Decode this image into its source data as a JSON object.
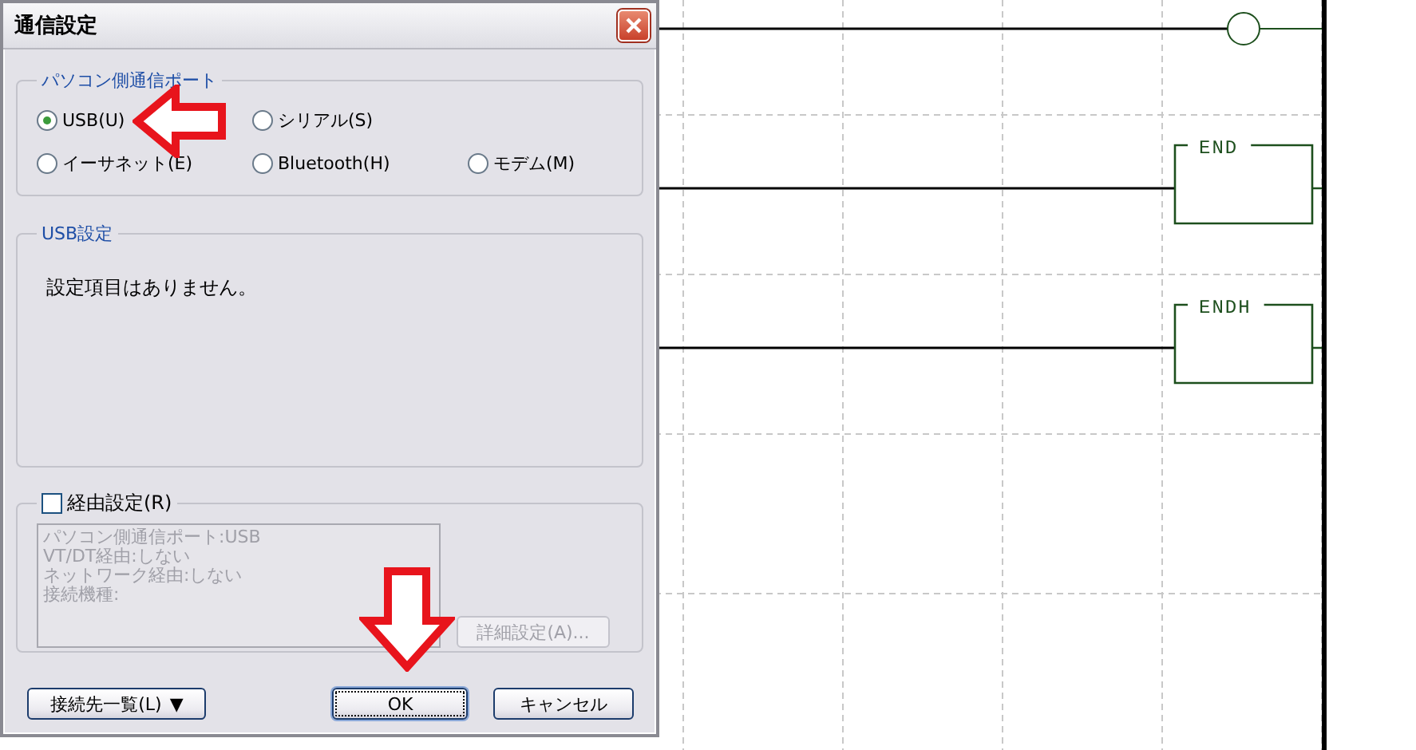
{
  "window": {
    "title": "通信設定"
  },
  "port_group": {
    "title": "パソコン側通信ポート",
    "rows": [
      [
        {
          "label": "USB(U)",
          "selected": true
        },
        {
          "label": "シリアル(S)",
          "selected": false
        }
      ],
      [
        {
          "label": "イーサネット(E)",
          "selected": false
        },
        {
          "label": "Bluetooth(H)",
          "selected": false
        },
        {
          "label": "モデム(M)",
          "selected": false
        }
      ]
    ]
  },
  "usb_settings": {
    "title": "USB設定",
    "message": "設定項目はありません。"
  },
  "routing": {
    "label": "経由設定(R)",
    "checked": false,
    "summary": [
      "パソコン側通信ポート:USB",
      "VT/DT経由:しない",
      "ネットワーク経由:しない",
      "接続機種:"
    ],
    "details_button": {
      "label": "詳細設定(A)...",
      "disabled": true
    }
  },
  "buttons": [
    {
      "kind": "dropdown",
      "label": "接続先一覧(L)",
      "caret": "▼",
      "default": false
    },
    {
      "kind": "push",
      "label": "OK",
      "default": true
    },
    {
      "kind": "push",
      "label": "キャンセル",
      "default": false
    }
  ],
  "ladder": {
    "rungs": [
      {
        "kind": "coil"
      },
      {
        "kind": "instruction",
        "label": "END"
      },
      {
        "kind": "instruction",
        "label": "ENDH"
      }
    ]
  },
  "annotations": [
    {
      "kind": "left-arrow"
    },
    {
      "kind": "down-arrow"
    }
  ]
}
